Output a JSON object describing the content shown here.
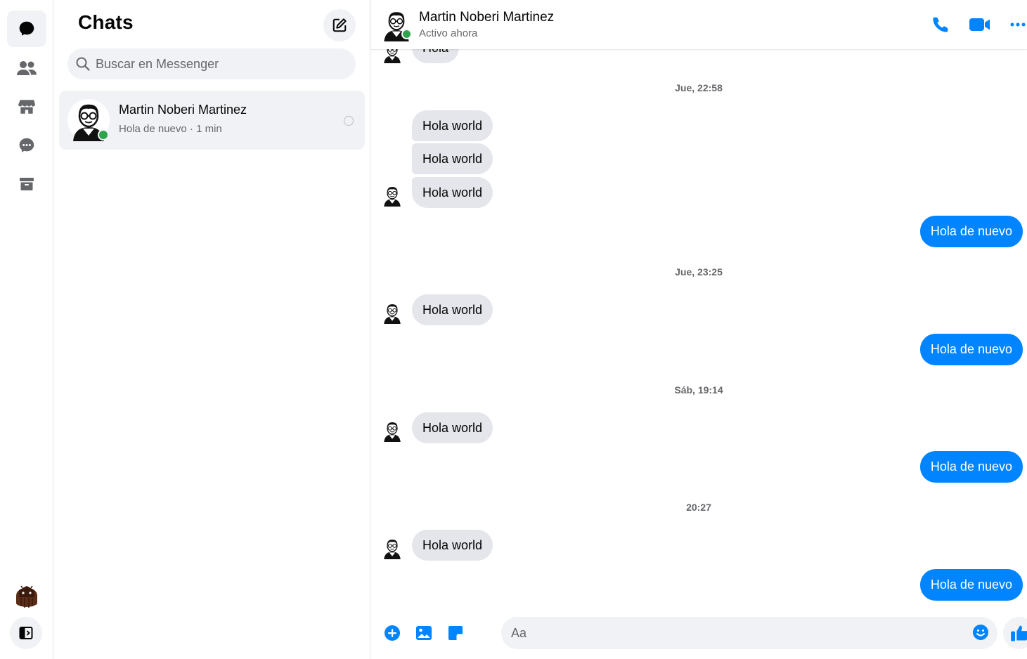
{
  "colors": {
    "accent": "#0084ff",
    "online": "#31a24c",
    "bubble_in": "#e4e6eb",
    "muted": "#65676b"
  },
  "rail": {
    "items": [
      {
        "name": "chats",
        "icon": "chat-bubble-icon",
        "active": true
      },
      {
        "name": "people",
        "icon": "people-icon",
        "active": false
      },
      {
        "name": "marketplace",
        "icon": "store-icon",
        "active": false
      },
      {
        "name": "requests",
        "icon": "message-dots-icon",
        "active": false
      },
      {
        "name": "archived",
        "icon": "archive-icon",
        "active": false
      }
    ],
    "bottom": {
      "avatar_icon": "android-avatar",
      "toggle_icon": "sidebar-toggle-icon"
    }
  },
  "list": {
    "title": "Chats",
    "compose_icon": "compose-icon",
    "search": {
      "placeholder": "Buscar en Messenger",
      "icon": "search-icon"
    },
    "conversations": [
      {
        "name": "Martin Noberi Martinez",
        "preview": "Hola de nuevo",
        "time": "1 min",
        "online": true
      }
    ]
  },
  "chat": {
    "header": {
      "name": "Martin Noberi Martinez",
      "status": "Activo ahora",
      "icons": [
        "phone-icon",
        "video-icon",
        "more-icon"
      ]
    },
    "partial_top_message": "Hola",
    "timestamps": [
      "Jue, 22:58",
      "Jue, 23:25",
      "Sáb, 19:14",
      "20:27"
    ],
    "messages": [
      {
        "dir": "in",
        "text": "Hola world"
      },
      {
        "dir": "in",
        "text": "Hola world"
      },
      {
        "dir": "in",
        "text": "Hola world"
      },
      {
        "dir": "out",
        "text": "Hola de nuevo"
      },
      {
        "dir": "in",
        "text": "Hola world"
      },
      {
        "dir": "out",
        "text": "Hola de nuevo"
      },
      {
        "dir": "in",
        "text": "Hola world"
      },
      {
        "dir": "out",
        "text": "Hola de nuevo"
      },
      {
        "dir": "in",
        "text": "Hola world"
      },
      {
        "dir": "out",
        "text": "Hola de nuevo"
      }
    ],
    "composer": {
      "placeholder": "Aa",
      "icons": [
        "plus-circle-icon",
        "image-icon",
        "sticker-icon",
        "emoji-icon",
        "thumbs-up-icon"
      ]
    }
  }
}
